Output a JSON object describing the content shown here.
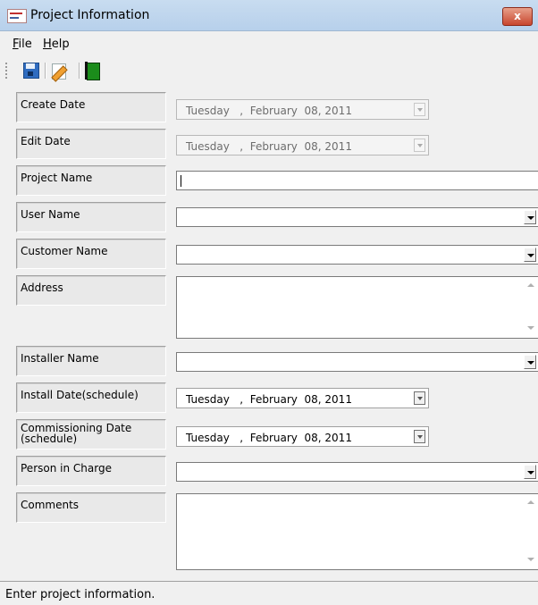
{
  "window": {
    "title": "Project Information",
    "close_label": "x"
  },
  "menu": {
    "file_label": "File",
    "help_label": "Help"
  },
  "toolbar": {
    "icons": [
      "save-icon",
      "edit-icon",
      "exit-icon"
    ]
  },
  "fields": {
    "create_date": {
      "label": "Create Date",
      "value": "Tuesday   ,  February  08, 2011"
    },
    "edit_date": {
      "label": "Edit Date",
      "value": "Tuesday   ,  February  08, 2011"
    },
    "project_name": {
      "label": "Project Name",
      "value": ""
    },
    "user_name": {
      "label": "User Name",
      "value": ""
    },
    "customer_name": {
      "label": "Customer Name",
      "value": ""
    },
    "address": {
      "label": "Address",
      "value": ""
    },
    "installer_name": {
      "label": "Installer Name",
      "value": ""
    },
    "install_date": {
      "label": "Install Date(schedule)",
      "value": "Tuesday   ,  February  08, 2011"
    },
    "commissioning_date": {
      "label": "Commissioning Date (schedule)",
      "value": "Tuesday   ,  February  08, 2011"
    },
    "person_in_charge": {
      "label": "Person in Charge",
      "value": ""
    },
    "comments": {
      "label": "Comments",
      "value": ""
    }
  },
  "status": {
    "text": "Enter project information."
  },
  "colors": {
    "titlebar": "#c8dcf0",
    "background": "#f0f0f0",
    "close": "#c8462e"
  }
}
